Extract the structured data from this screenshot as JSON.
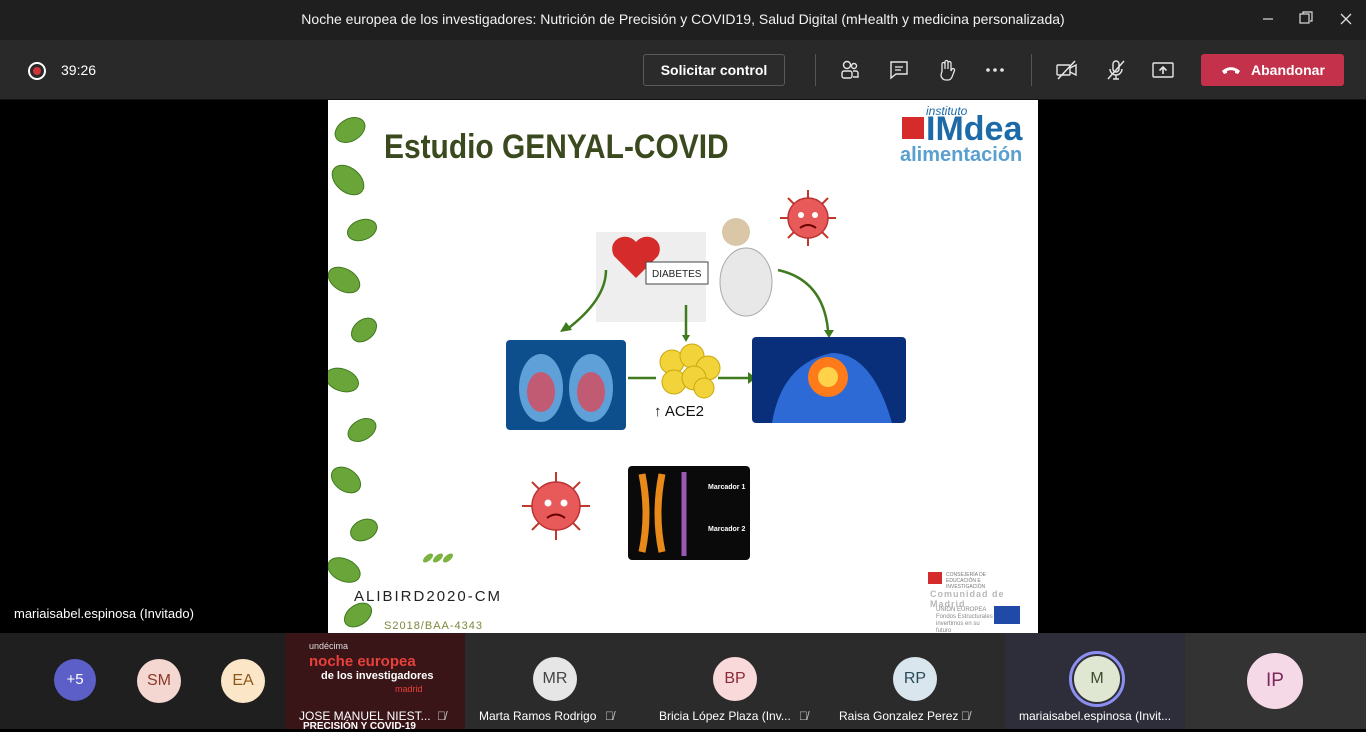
{
  "window": {
    "title": "Noche europea de los investigadores: Nutrición de Precisión y COVID19, Salud Digital (mHealth y medicina personalizada)",
    "minimize_icon": "minimize-icon",
    "maximize_icon": "restore-icon",
    "close_icon": "close-icon"
  },
  "toolbar": {
    "timer": "39:26",
    "request_control_label": "Solicitar control",
    "leave_label": "Abandonar",
    "icons": [
      "participants-icon",
      "chat-icon",
      "raise-hand-icon",
      "more-icon",
      "camera-off-icon",
      "mic-off-icon",
      "share-icon"
    ],
    "leave_color": "#c4314b"
  },
  "slide": {
    "title": "Estudio GENYAL-COVID",
    "brand_small": "instituto",
    "brand_main": "IMdea",
    "brand_sub": "alimentación",
    "ace_label": "ACE2",
    "marker1": "Marcador 1",
    "marker2": "Marcador 2",
    "diabetes": "DIABETES",
    "project_code": "ALIBIRD2020-CM",
    "grant_code": "S2018/BAA-4343",
    "cm_label": "Comunidad de Madrid",
    "consejeria": "CONSEJERÍA DE EDUCACIÓN E INVESTIGACIÓN",
    "ue_label": "UNIÓN EUROPEA",
    "ue_sub": "Fondos Estructurales",
    "ue_sub2": "invertimos en su futuro"
  },
  "presenter_name": "mariaisabel.espinosa (Invitado)",
  "participants": {
    "overflow": "+5",
    "avatars": [
      {
        "initials": "SM",
        "bg": "#f4d7d0",
        "fg": "#8a3a2a"
      },
      {
        "initials": "EA",
        "bg": "#fce6c8",
        "fg": "#8a5a1a"
      }
    ],
    "tiles": [
      {
        "name": "JOSE MANUEL NIEST...",
        "banner_line1": "undécima",
        "banner_line2": "noche europea",
        "banner_line3": "de los investigadores",
        "banner_line4": "madrid",
        "extra": "PRECISIÓN Y COVID-19"
      },
      {
        "name": "Marta Ramos Rodrigo",
        "initials": "MR",
        "bg": "#e6e6e6",
        "fg": "#444"
      },
      {
        "name": "Bricia López Plaza (Inv...",
        "initials": "BP",
        "bg": "#f9d9da",
        "fg": "#8a2a3a"
      },
      {
        "name": "Raisa Gonzalez Perez",
        "initials": "RP",
        "bg": "#d9e6ee",
        "fg": "#2a4a5a"
      },
      {
        "name": "mariaisabel.espinosa (Invit...",
        "initials": "M",
        "bg": "#dfe6d2",
        "fg": "#3a4a2a"
      },
      {
        "name": "",
        "initials": "IP",
        "bg": "#f5d9e6",
        "fg": "#7a2a5a"
      }
    ]
  }
}
